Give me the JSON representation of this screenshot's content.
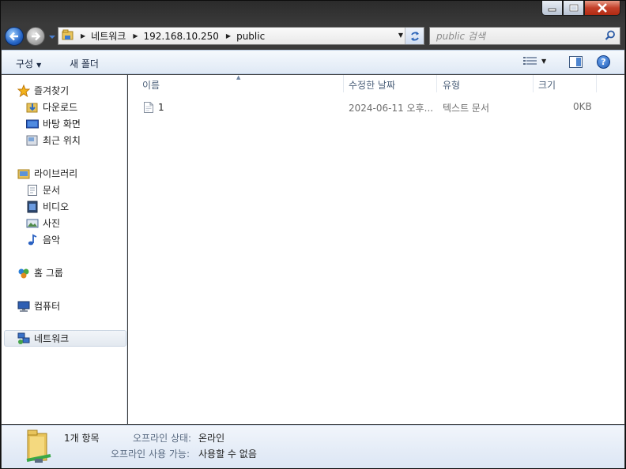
{
  "address": {
    "crumbs": [
      "네트워크",
      "192.168.10.250",
      "public"
    ]
  },
  "search": {
    "placeholder": "public 검색"
  },
  "toolbar": {
    "organize_label": "구성",
    "new_folder_label": "새 폴더"
  },
  "nav": {
    "favorites": {
      "label": "즐겨찾기",
      "icon": "star-icon"
    },
    "downloads": {
      "label": "다운로드",
      "icon": "downloads-folder-icon"
    },
    "desktop": {
      "label": "바탕 화면",
      "icon": "desktop-icon"
    },
    "recent": {
      "label": "최근 위치",
      "icon": "recent-places-icon"
    },
    "libraries": {
      "label": "라이브러리",
      "icon": "library-icon"
    },
    "documents": {
      "label": "문서",
      "icon": "documents-icon"
    },
    "videos": {
      "label": "비디오",
      "icon": "video-icon"
    },
    "pictures": {
      "label": "사진",
      "icon": "pictures-icon"
    },
    "music": {
      "label": "음악",
      "icon": "music-note-icon"
    },
    "homegroup": {
      "label": "홈 그룹",
      "icon": "homegroup-icon"
    },
    "computer": {
      "label": "컴퓨터",
      "icon": "computer-icon"
    },
    "network": {
      "label": "네트워크",
      "icon": "network-icon",
      "selected": true
    }
  },
  "columns": {
    "name": "이름",
    "modified": "수정한 날짜",
    "type": "유형",
    "size": "크기"
  },
  "files": [
    {
      "name": "1",
      "modified": "2024-06-11 오후...",
      "type": "텍스트 문서",
      "size": "0KB",
      "icon": "text-file-icon"
    }
  ],
  "details": {
    "count": "1개 항목",
    "offline_status_label": "오프라인 상태:",
    "offline_status_value": "온라인",
    "offline_avail_label": "오프라인 사용 가능:",
    "offline_avail_value": "사용할 수 없음"
  },
  "colors": {
    "accent": "#1f5bb5",
    "cmdbar": "#dfe9f5",
    "selected_nav": "#e3e9f0"
  }
}
